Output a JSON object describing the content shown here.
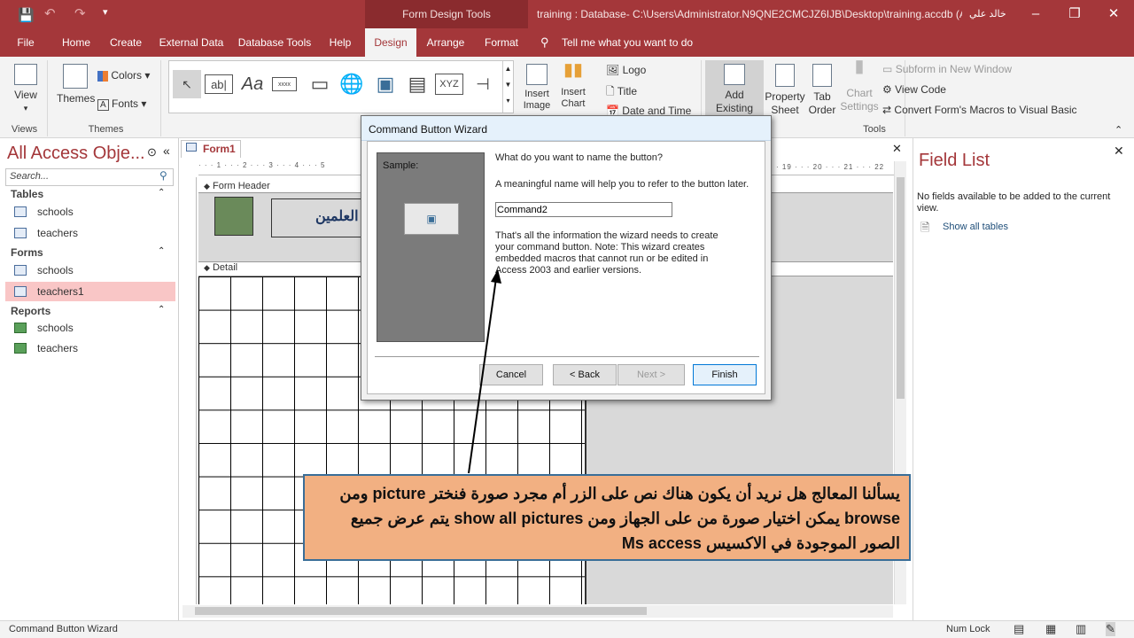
{
  "titlebar": {
    "context_tools": "Form Design Tools",
    "title": "training : Database- C:\\Users\\Administrator.N9QNE2CMCJZ6IJB\\Desktop\\training.accdb (Acce...",
    "user": "خالد علي"
  },
  "tabs": [
    {
      "label": "File"
    },
    {
      "label": "Home"
    },
    {
      "label": "Create"
    },
    {
      "label": "External Data"
    },
    {
      "label": "Database Tools"
    },
    {
      "label": "Help"
    },
    {
      "label": "Design"
    },
    {
      "label": "Arrange"
    },
    {
      "label": "Format"
    }
  ],
  "tell_me": "Tell me what you want to do",
  "ribbon": {
    "views": {
      "view": "View",
      "group": "Views"
    },
    "themes": {
      "themes": "Themes",
      "colors": "Colors",
      "fonts": "Fonts",
      "group": "Themes"
    },
    "controls": {
      "textbox": "ab|",
      "label": "Aa",
      "button": "xxxx",
      "xyz": "XYZ"
    },
    "insert_image": "Insert Image",
    "insert_chart": "Insert Chart",
    "header": {
      "logo": "Logo",
      "title": "Title",
      "date_time": "Date and Time"
    },
    "tools": {
      "add_existing": "Add Existing Fields",
      "property": "Property Sheet",
      "tab_order": "Tab Order",
      "chart_settings": "Chart Settings",
      "subform": "Subform in New Window",
      "view_code": "View Code",
      "convert": "Convert Form's Macros to Visual Basic",
      "group": "Tools"
    }
  },
  "nav": {
    "title": "All Access Obje...",
    "search": "Search...",
    "sections": [
      {
        "label": "Tables",
        "items": [
          "schools",
          "teachers"
        ]
      },
      {
        "label": "Forms",
        "items": [
          "schools",
          "teachers1"
        ]
      },
      {
        "label": "Reports",
        "items": [
          "schools",
          "teachers"
        ]
      }
    ]
  },
  "document": {
    "tab": "Form1",
    "form_header": "Form Header",
    "detail": "Detail",
    "header_text": "العلمين",
    "ruler_top": "· · · 1 · · · 2 · · · 3 · · · 4 · · · 5",
    "ruler_right": "· 19 · · · 20 · · · 21 · · · 22"
  },
  "wizard": {
    "title": "Command Button Wizard",
    "sample": "Sample:",
    "question": "What do you want to name the button?",
    "hint": "A meaningful name will help you to refer to the button later.",
    "name_value": "Command2",
    "info": "That's all the information the wizard needs to create your command button. Note: This wizard creates embedded macros that cannot run or be edited in Access 2003 and earlier versions.",
    "cancel": "Cancel",
    "back": "< Back",
    "next": "Next >",
    "finish": "Finish"
  },
  "fieldlist": {
    "title": "Field List",
    "empty": "No fields available to be added to the current view.",
    "show_all": "Show all tables"
  },
  "callout": {
    "text": "يسألنا المعالج هل نريد أن يكون هناك نص على الزر أم مجرد صورة فنختر picture ومن browse يمكن اختيار صورة من على الجهاز ومن show all pictures يتم عرض جميع الصور الموجودة في الاكسيس Ms access"
  },
  "status": {
    "left": "Command Button Wizard",
    "numlock": "Num Lock"
  },
  "colors": {
    "accent": "#a4373a",
    "callout_bg": "#f2b082",
    "callout_border": "#3a6e98"
  }
}
